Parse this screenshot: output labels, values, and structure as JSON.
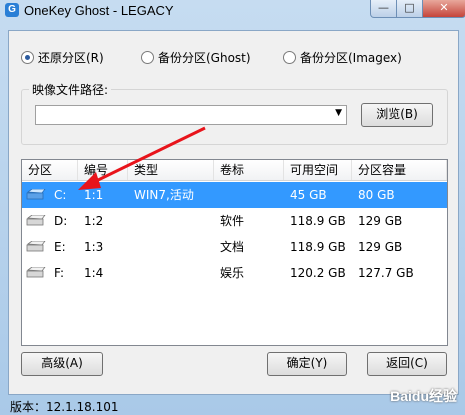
{
  "window": {
    "title": "OneKey Ghost - LEGACY",
    "app_icon": "G",
    "controls": {
      "minimize": "—",
      "maximize": "□",
      "close": "✕"
    }
  },
  "modes": [
    {
      "label": "还原分区(R)",
      "checked": true
    },
    {
      "label": "备份分区(Ghost)",
      "checked": false
    },
    {
      "label": "备份分区(Imagex)",
      "checked": false
    }
  ],
  "image_path": {
    "label": "映像文件路径:",
    "value": "",
    "browse_label": "浏览(B)"
  },
  "table": {
    "columns": [
      "分区",
      "编号",
      "类型",
      "卷标",
      "可用空间",
      "分区容量"
    ],
    "rows": [
      {
        "drive": "C:",
        "number": "1:1",
        "type": "WIN7,活动",
        "label": "",
        "free": "45 GB",
        "size": "80 GB",
        "selected": true
      },
      {
        "drive": "D:",
        "number": "1:2",
        "type": "",
        "label": "软件",
        "free": "118.9 GB",
        "size": "129 GB",
        "selected": false
      },
      {
        "drive": "E:",
        "number": "1:3",
        "type": "",
        "label": "文档",
        "free": "118.9 GB",
        "size": "129 GB",
        "selected": false
      },
      {
        "drive": "F:",
        "number": "1:4",
        "type": "",
        "label": "娱乐",
        "free": "120.2 GB",
        "size": "127.7 GB",
        "selected": false
      }
    ]
  },
  "buttons": {
    "advanced": "高级(A)",
    "ok": "确定(Y)",
    "back": "返回(C)"
  },
  "footer": {
    "version": "版本：12.1.18.101"
  },
  "watermark": "Baidu经验",
  "colors": {
    "selection": "#3399ff",
    "arrow": "#e8141b"
  }
}
